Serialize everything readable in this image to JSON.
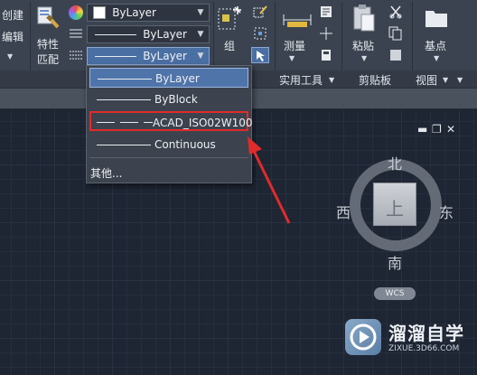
{
  "ribbon": {
    "left_labels": [
      "创建",
      "编辑"
    ],
    "match_properties": [
      "特性",
      "匹配"
    ],
    "color_combo": "ByLayer",
    "linetype_combo": "ByLayer",
    "lineweight_combo": "ByLayer",
    "group_label": "组",
    "measure_label": "测量",
    "paste_label": "粘贴",
    "base_label": "基点",
    "panels": {
      "utilities": "实用工具",
      "clipboard": "剪贴板",
      "view": "视图"
    }
  },
  "linetype_dropdown": {
    "options": [
      {
        "label": "ByLayer",
        "state": "selected"
      },
      {
        "label": "ByBlock",
        "state": "normal"
      },
      {
        "label": "ACAD_ISO02W100",
        "state": "highlighted"
      },
      {
        "label": "Continuous",
        "state": "normal"
      }
    ],
    "other_label": "其他..."
  },
  "viewcube": {
    "north": "北",
    "south": "南",
    "west": "西",
    "east": "东",
    "face": "上",
    "wcs": "WCS"
  },
  "watermark": {
    "title": "溜溜自学",
    "url": "ZIXUE.3D66.COM"
  },
  "colors": {
    "ribbon_bg": "#3b4350",
    "canvas_bg": "#1e2533",
    "selection_blue": "#4f74aa",
    "highlight_red": "#e02b2b"
  }
}
